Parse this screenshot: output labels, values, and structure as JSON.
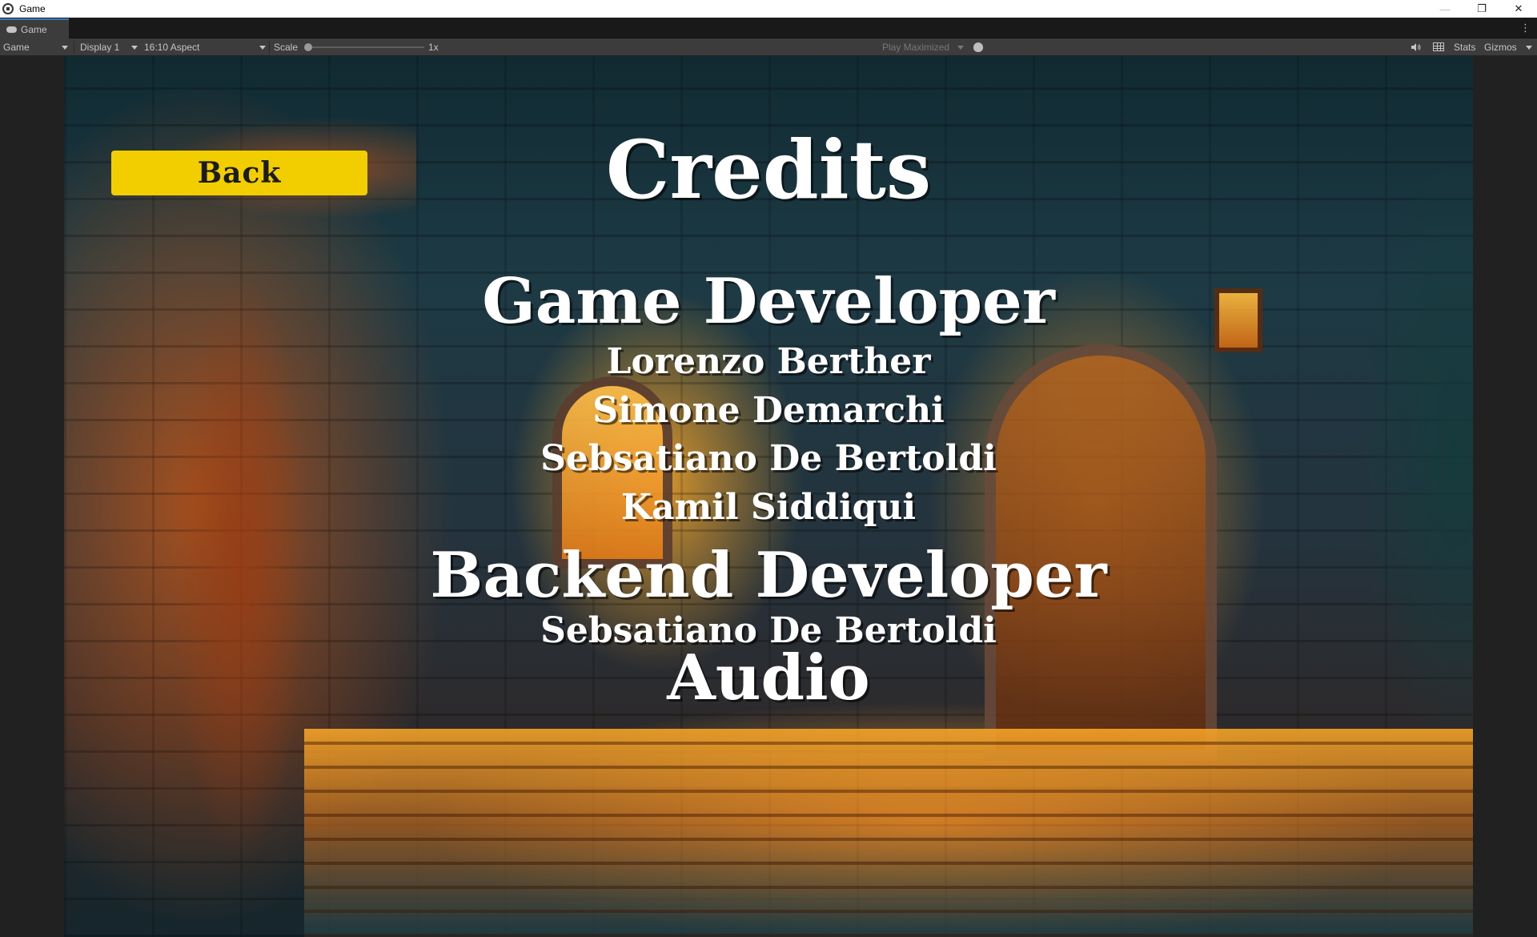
{
  "window": {
    "title": "Game"
  },
  "tab": {
    "label": "Game"
  },
  "toolbar": {
    "view_select": "Game",
    "display_select": "Display 1",
    "aspect_select": "16:10 Aspect",
    "scale_label": "Scale",
    "scale_value": "1x",
    "scale_slider_level": 0,
    "play_mode_select": "Play Maximized",
    "stats_label": "Stats",
    "gizmos_label": "Gizmos"
  },
  "game": {
    "back_button_label": "Back",
    "back_button_color": "#f2cd00",
    "credits_title": "Credits",
    "sections": [
      {
        "heading": "Game Developer",
        "names": [
          "Lorenzo Berther",
          "Simone Demarchi",
          "Sebsatiano De Bertoldi",
          "Kamil Siddiqui"
        ]
      },
      {
        "heading": "Backend Developer",
        "names": [
          "Sebsatiano De Bertoldi"
        ]
      },
      {
        "heading": "Audio",
        "names": []
      }
    ]
  }
}
